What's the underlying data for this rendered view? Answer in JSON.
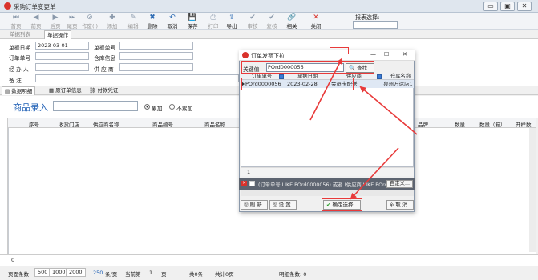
{
  "window": {
    "title": "采购订单变更单",
    "min": "▭",
    "max": "▣",
    "close": "✕"
  },
  "toolbar": {
    "items": [
      {
        "label": "首页",
        "icon": "⏮",
        "enabled": false
      },
      {
        "label": "前页",
        "icon": "◀",
        "enabled": false
      },
      {
        "label": "后页",
        "icon": "▶",
        "enabled": false
      },
      {
        "label": "尾页",
        "icon": "⏭",
        "enabled": false
      },
      {
        "label": "作废(I)",
        "icon": "⊘",
        "enabled": false
      },
      {
        "label": "添加",
        "icon": "✚",
        "enabled": false
      },
      {
        "label": "编辑",
        "icon": "✎",
        "enabled": false
      },
      {
        "label": "删除",
        "icon": "✖",
        "enabled": true
      },
      {
        "label": "取消",
        "icon": "↶",
        "enabled": true
      },
      {
        "label": "保存",
        "icon": "💾",
        "enabled": true
      },
      {
        "label": "打印",
        "icon": "⎙",
        "enabled": false
      },
      {
        "label": "导出",
        "icon": "⇪",
        "enabled": true
      },
      {
        "label": "审核",
        "icon": "✔",
        "enabled": false
      },
      {
        "label": "复核",
        "icon": "✔",
        "enabled": false
      },
      {
        "label": "相关",
        "icon": "🔗",
        "enabled": true
      },
      {
        "label": "关闭",
        "icon": "✕",
        "enabled": true
      }
    ],
    "search_label": "报表选择:"
  },
  "tabs": {
    "list": "单据列表",
    "edit": "单据操作"
  },
  "form": {
    "date_label": "单据日期",
    "date_value": "2023-03-01",
    "doc_no_label": "单据单号",
    "order_no_label": "订单单号",
    "warehouse_label": "仓库信息",
    "operator_label": "经 办 人",
    "supplier_label": "供 应 商",
    "remark_label": "备    注"
  },
  "subtabs": {
    "detail": "数据明细",
    "orig": "原订单信息",
    "payment": "付款凭证"
  },
  "entry": {
    "label": "商品录入",
    "radio1": "累加",
    "radio2": "不累加"
  },
  "grid": {
    "columns": [
      "序号",
      "收货门店",
      "供应商名称",
      "商品编号",
      "商品名称",
      "品牌",
      "数量",
      "数量（箱）",
      "开样数"
    ],
    "footer_count": "0"
  },
  "status": {
    "page_size_label": "页面条数",
    "sizes": [
      "500",
      "1000",
      "2000"
    ],
    "current_size": "250",
    "per_page": "条/页",
    "current_label": "当前第",
    "current_page": "1",
    "page_unit": "页",
    "total": "共0条",
    "total_pages": "共计0页",
    "detail_count": "明细条数: 0"
  },
  "dialog": {
    "title": "订单发票下拉",
    "min": "—",
    "max": "☐",
    "close": "✕",
    "keyword_label": "关键值",
    "keyword_value": "POrd0000056",
    "find_label": "查找",
    "columns": [
      "订单单号",
      "单据日期",
      "供应商",
      "仓库名称"
    ],
    "row": {
      "order_no": "POrd0000056",
      "date": "2023-02-28",
      "supplier": "会员卡配送",
      "warehouse": "泉州万达店1"
    },
    "footer_count": "1",
    "filter_text": "(订单单号 LIKE POrd0000056) 或者 (供应商 LIKE POrd0",
    "customize": "自定义...",
    "refresh": "刷 新",
    "settings": "设 置",
    "confirm": "确定选择",
    "cancel": "取 消"
  },
  "colors": {
    "accent": "#1e5fb5",
    "highlight": "#e83a3a",
    "selected_row": "#dfe8f4"
  }
}
